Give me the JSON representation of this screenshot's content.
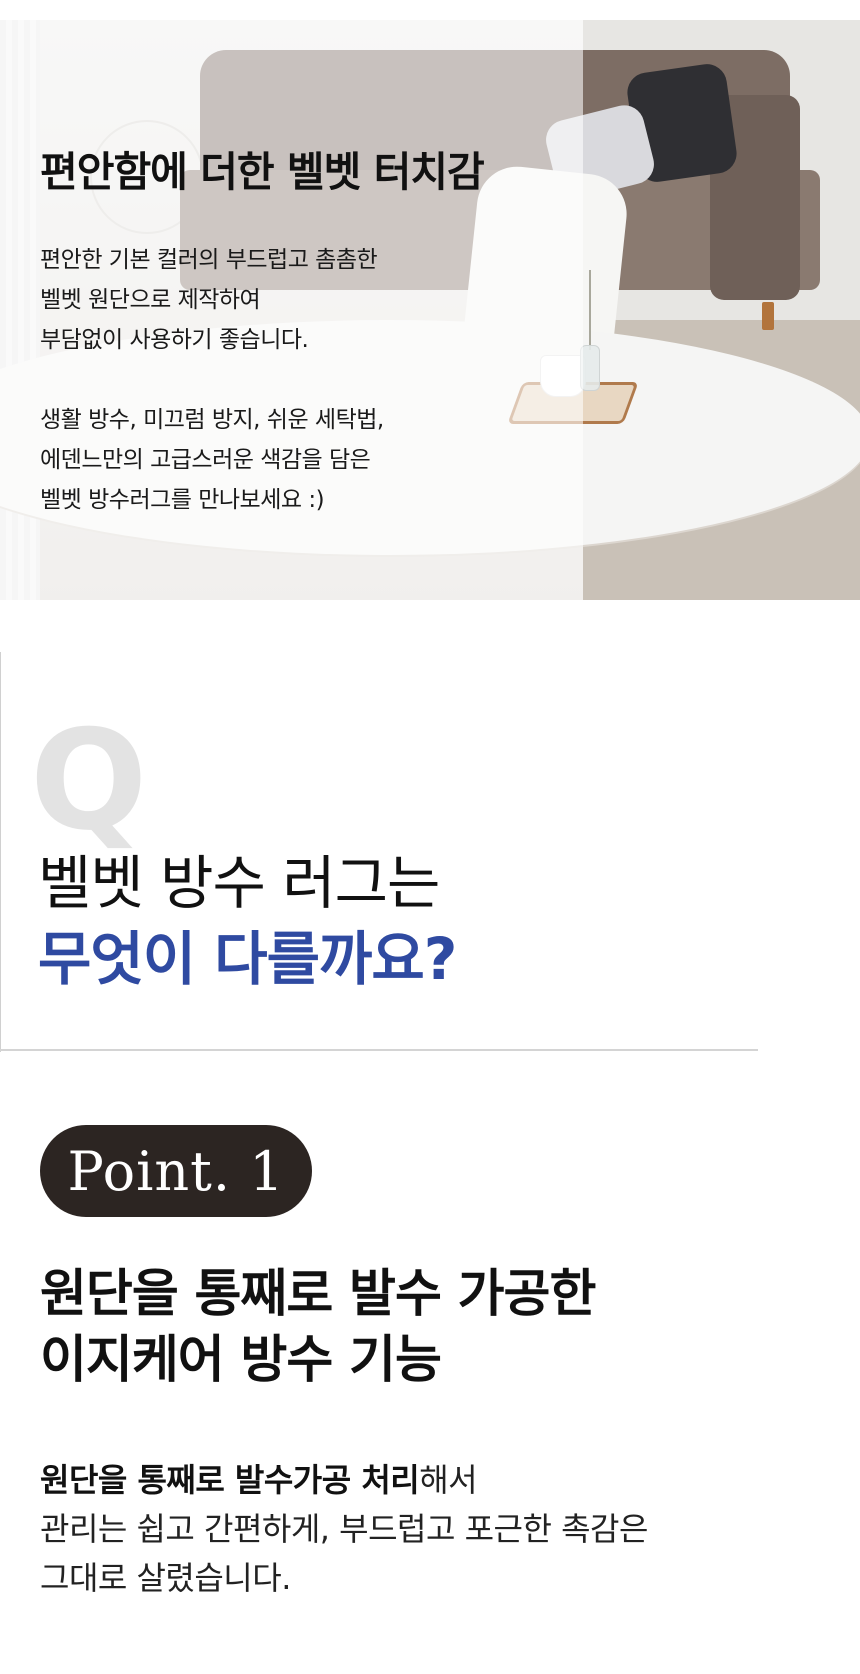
{
  "hero": {
    "title": "편안함에 더한 벨벳 터치감",
    "para1": [
      "편안한 기본 컬러의 부드럽고 촘촘한",
      "벨벳 원단으로 제작하여",
      "부담없이 사용하기 좋습니다."
    ],
    "para2": [
      "생활 방수, 미끄럼 방지, 쉬운 세탁법,",
      "에덴느만의 고급스러운 색감을 담은",
      "벨벳 방수러그를 만나보세요 :)"
    ]
  },
  "qa": {
    "letter": "Q",
    "line1": "벨벳 방수 러그는",
    "line2": "무엇이 다를까요?",
    "accent_color": "#2f4aa1"
  },
  "point": {
    "badge": "Point. 1",
    "title": [
      "원단을 통째로 발수 가공한",
      "이지케어 방수 기능"
    ],
    "desc_bold": "원단을 통째로 발수가공 처리",
    "desc_rest": "해서",
    "desc_lines": [
      "관리는 쉽고 간편하게, 부드럽고 포근한 촉감은",
      "그대로 살렸습니다."
    ]
  }
}
